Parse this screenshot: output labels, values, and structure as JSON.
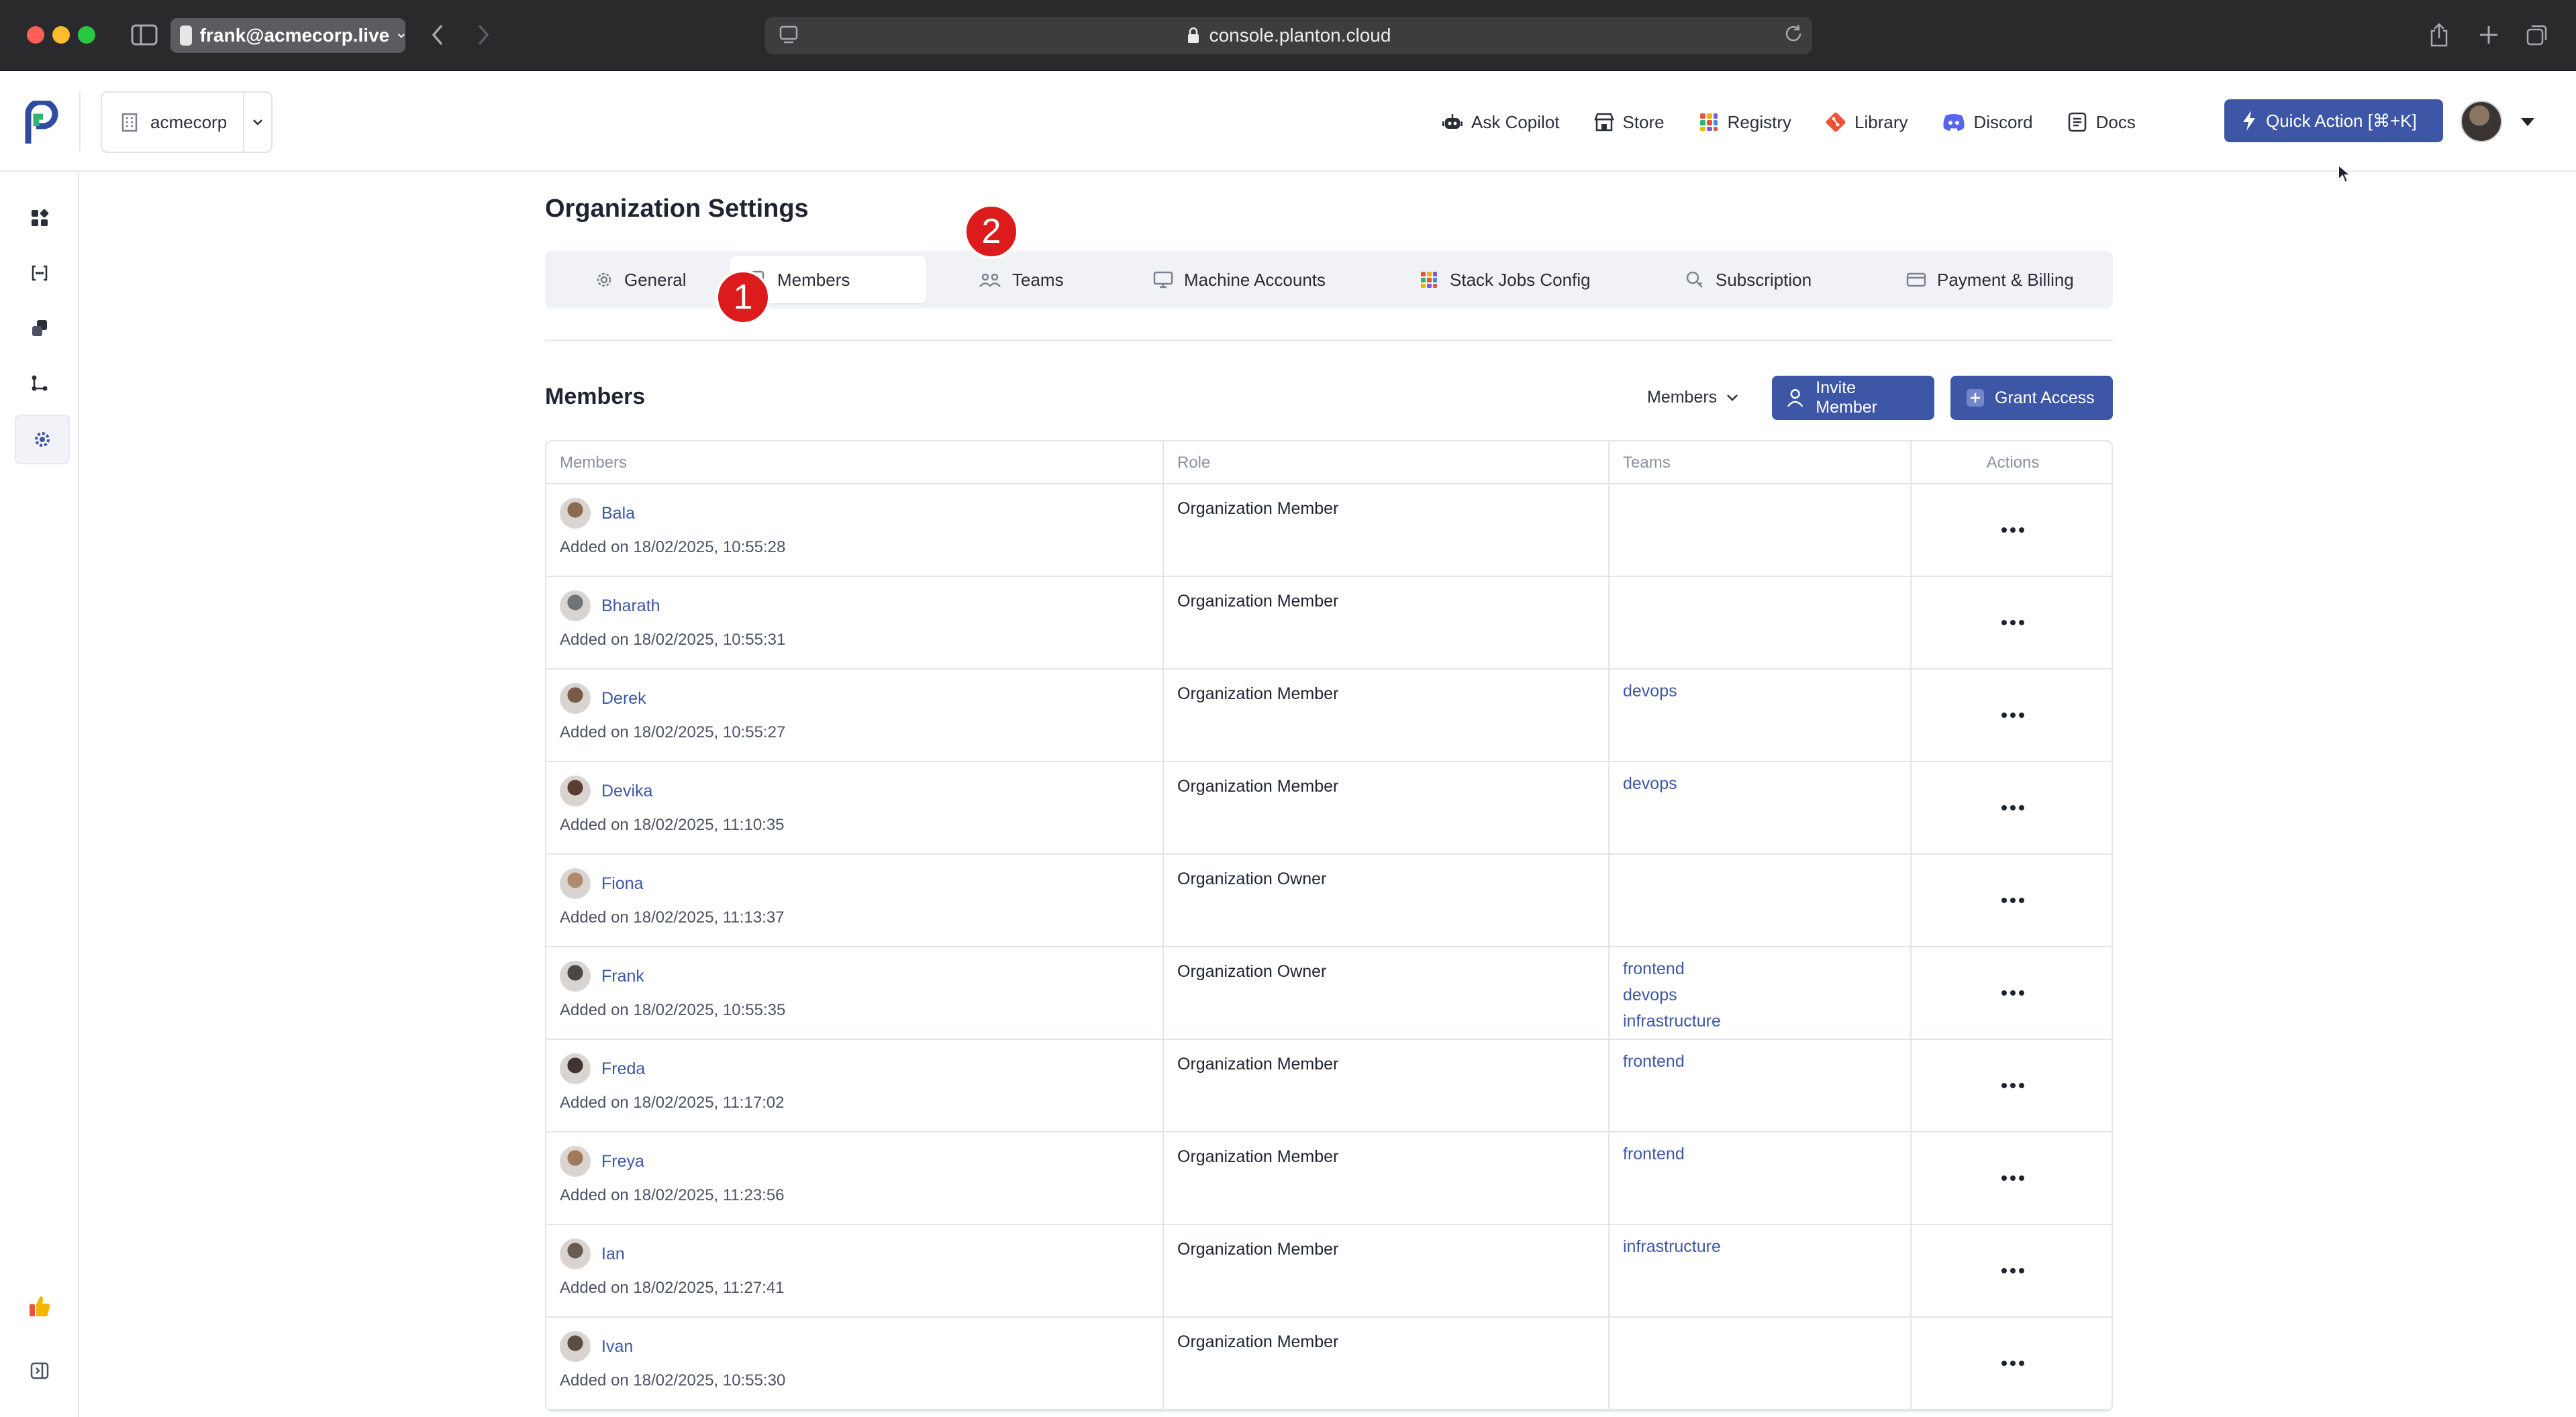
{
  "browser": {
    "profile_label": "frank@acmecorp.live",
    "url": "console.planton.cloud"
  },
  "header": {
    "org_name": "acmecorp",
    "links": [
      {
        "label": "Ask Copilot",
        "icon": "robot-icon"
      },
      {
        "label": "Store",
        "icon": "store-icon"
      },
      {
        "label": "Registry",
        "icon": "registry-icon"
      },
      {
        "label": "Library",
        "icon": "git-icon"
      },
      {
        "label": "Discord",
        "icon": "discord-icon"
      },
      {
        "label": "Docs",
        "icon": "docs-icon"
      }
    ],
    "quick_action_label": "Quick Action [⌘+K]"
  },
  "page": {
    "title": "Organization Settings",
    "tabs": [
      {
        "label": "General",
        "icon": "gear-icon"
      },
      {
        "label": "Members",
        "icon": "members-icon",
        "active": true
      },
      {
        "label": "Teams",
        "icon": "teams-icon"
      },
      {
        "label": "Machine Accounts",
        "icon": "monitor-icon"
      },
      {
        "label": "Stack Jobs Config",
        "icon": "stack-icon"
      },
      {
        "label": "Subscription",
        "icon": "subscription-icon"
      },
      {
        "label": "Payment & Billing",
        "icon": "card-icon"
      }
    ],
    "markers": [
      "1",
      "2"
    ]
  },
  "members": {
    "section_title": "Members",
    "filter_label": "Members",
    "invite_label": "Invite Member",
    "grant_label": "Grant Access",
    "columns": [
      "Members",
      "Role",
      "Teams",
      "Actions"
    ],
    "rows": [
      {
        "name": "Bala",
        "added": "Added on 18/02/2025, 10:55:28",
        "role": "Organization Member",
        "teams": []
      },
      {
        "name": "Bharath",
        "added": "Added on 18/02/2025, 10:55:31",
        "role": "Organization Member",
        "teams": []
      },
      {
        "name": "Derek",
        "added": "Added on 18/02/2025, 10:55:27",
        "role": "Organization Member",
        "teams": [
          "devops"
        ]
      },
      {
        "name": "Devika",
        "added": "Added on 18/02/2025, 11:10:35",
        "role": "Organization Member",
        "teams": [
          "devops"
        ]
      },
      {
        "name": "Fiona",
        "added": "Added on 18/02/2025, 11:13:37",
        "role": "Organization Owner",
        "teams": []
      },
      {
        "name": "Frank",
        "added": "Added on 18/02/2025, 10:55:35",
        "role": "Organization Owner",
        "teams": [
          "frontend",
          "devops",
          "infrastructure"
        ]
      },
      {
        "name": "Freda",
        "added": "Added on 18/02/2025, 11:17:02",
        "role": "Organization Member",
        "teams": [
          "frontend"
        ]
      },
      {
        "name": "Freya",
        "added": "Added on 18/02/2025, 11:23:56",
        "role": "Organization Member",
        "teams": [
          "frontend"
        ]
      },
      {
        "name": "Ian",
        "added": "Added on 18/02/2025, 11:27:41",
        "role": "Organization Member",
        "teams": [
          "infrastructure"
        ]
      },
      {
        "name": "Ivan",
        "added": "Added on 18/02/2025, 10:55:30",
        "role": "Organization Member",
        "teams": []
      }
    ]
  },
  "colors": {
    "primary": "#3e56a6",
    "marker": "#dc1c1c",
    "link": "#3e56a6"
  }
}
